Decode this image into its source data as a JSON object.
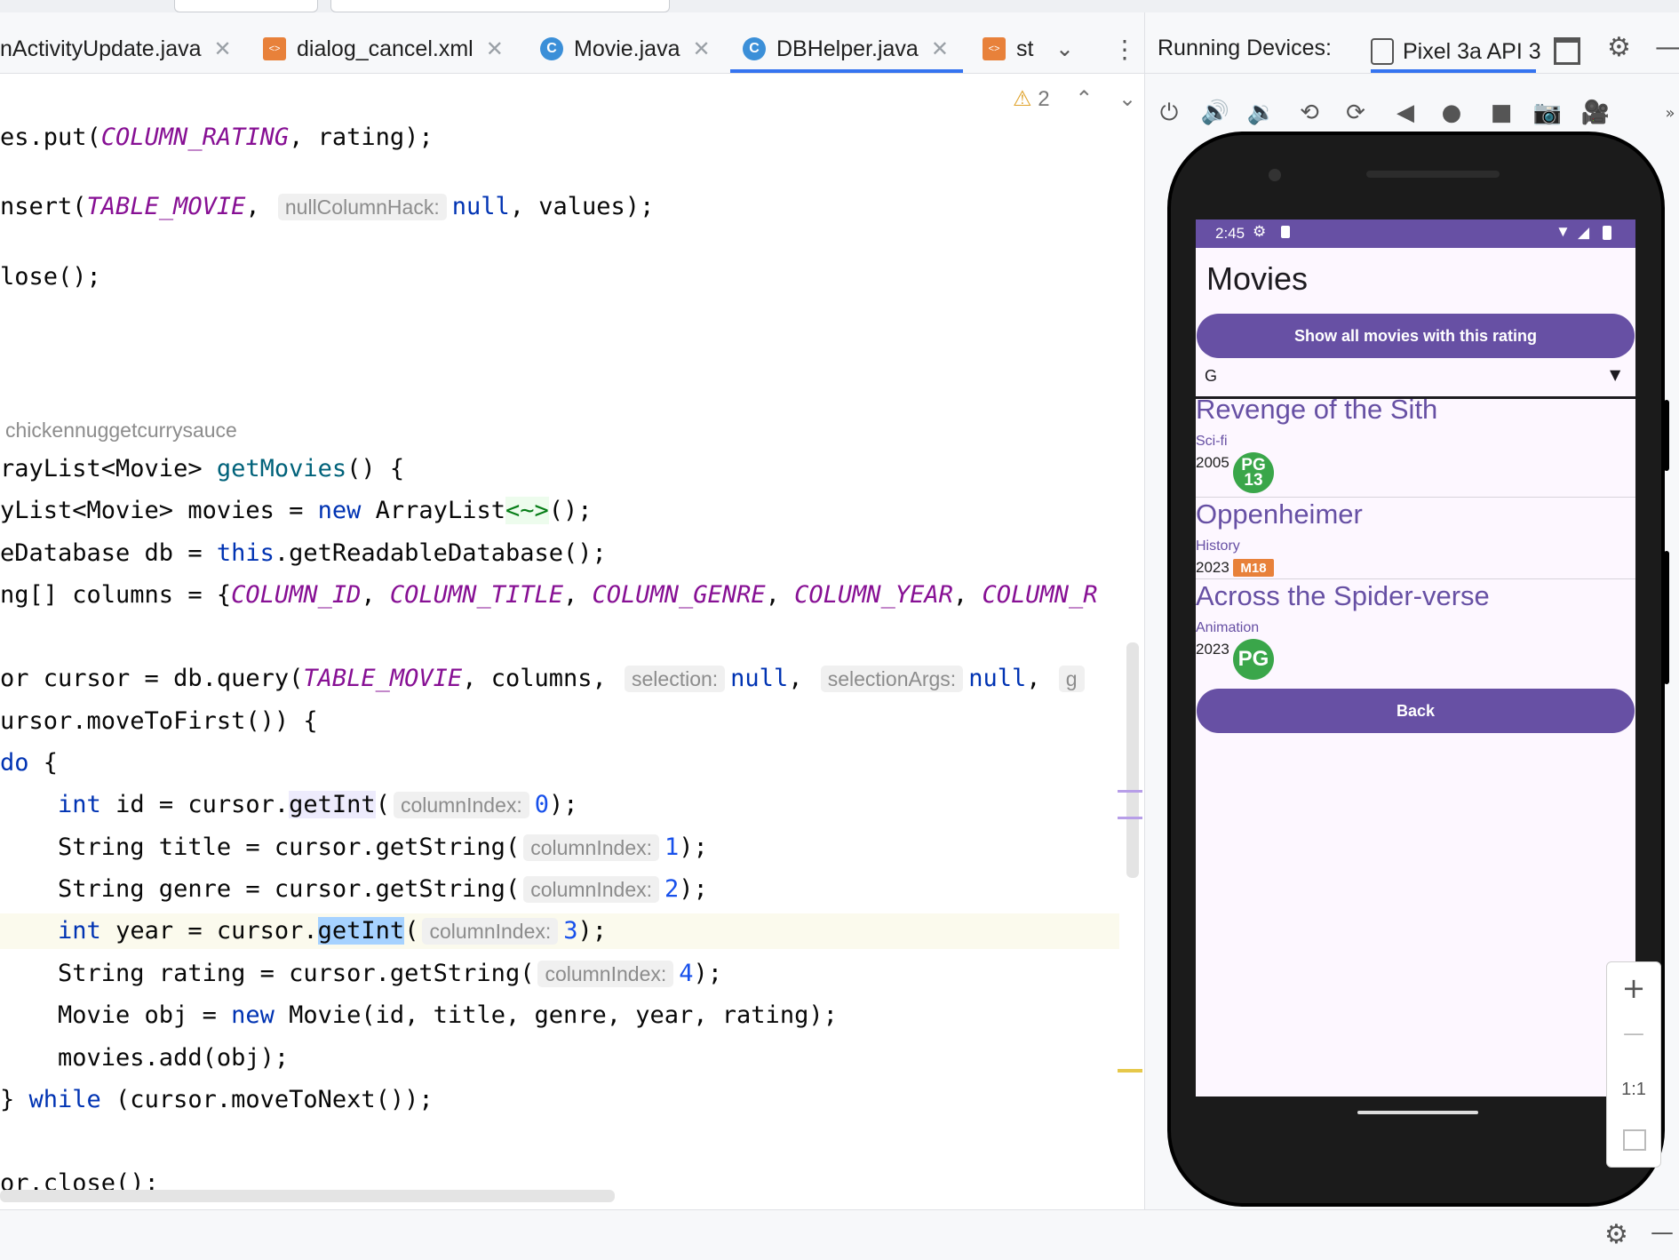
{
  "tabs": [
    {
      "label": "nActivityUpdate.java",
      "icon": "none"
    },
    {
      "label": "dialog_cancel.xml",
      "icon": "xml-file-icon"
    },
    {
      "label": "Movie.java",
      "icon": "class-icon"
    },
    {
      "label": "DBHelper.java",
      "icon": "class-icon",
      "active": true
    },
    {
      "label": "st",
      "icon": "xml-file-icon"
    }
  ],
  "editor": {
    "warning_count": "2",
    "author": "chickennuggetcurrysauce",
    "lines": {
      "l1a": "es.put(",
      "l1b": "COLUMN_RATING",
      "l1c": ", rating);",
      "l2a": "nsert(",
      "l2b": "TABLE_MOVIE",
      "l2c": ", ",
      "l2hint": "nullColumnHack:",
      "l2d": "null",
      "l2e": ", values);",
      "l3": "lose();",
      "l4a": "rayList<Movie> ",
      "l4b": "getMovies",
      "l4c": "() {",
      "l5a": "yList<Movie> movies = ",
      "l5b": "new",
      "l5c": " ArrayList",
      "l5d": "<~>",
      "l5e": "();",
      "l6a": "eDatabase db = ",
      "l6b": "this",
      "l6c": ".getReadableDatabase();",
      "l7a": "ng[] columns = {",
      "l7b": "COLUMN_ID",
      "l7c": ", ",
      "l7d": "COLUMN_TITLE",
      "l7e": ", ",
      "l7f": "COLUMN_GENRE",
      "l7g": ", ",
      "l7h": "COLUMN_YEAR",
      "l7i": ", ",
      "l7j": "COLUMN_R",
      "l8a": "or cursor = db.query(",
      "l8b": "TABLE_MOVIE",
      "l8c": ", columns, ",
      "l8hint1": "selection:",
      "l8d": "null",
      "l8e": ", ",
      "l8hint2": "selectionArgs:",
      "l8f": "null",
      "l8g": ", ",
      "l8hint3": "g",
      "l9": "ursor.moveToFirst()) {",
      "l10a": "do",
      "l10b": " {",
      "l11a": "    ",
      "l11b": "int",
      "l11c": " id = cursor.",
      "l11d": "getInt",
      "l11e": "(",
      "l11hint": "columnIndex:",
      "l11f": "0",
      "l11g": ");",
      "l12a": "    String title = cursor.getString(",
      "l12hint": "columnIndex:",
      "l12b": "1",
      "l12c": ");",
      "l13a": "    String genre = cursor.getString(",
      "l13hint": "columnIndex:",
      "l13b": "2",
      "l13c": ");",
      "l14a": "    ",
      "l14b": "int",
      "l14c": " year = cursor.",
      "l14d": "getInt",
      "l14e": "(",
      "l14hint": "columnIndex:",
      "l14f": "3",
      "l14g": ");",
      "l15a": "    String rating = cursor.getString(",
      "l15hint": "columnIndex:",
      "l15b": "4",
      "l15c": ");",
      "l16a": "    Movie obj = ",
      "l16b": "new",
      "l16c": " Movie(id, title, genre, year, rating);",
      "l17": "    movies.add(obj);",
      "l18a": "} ",
      "l18b": "while",
      "l18c": " (cursor.moveToNext());",
      "l19": "or.close();"
    }
  },
  "devices": {
    "title": "Running Devices:",
    "device_tab": "Pixel 3a API 3"
  },
  "phone": {
    "status_time": "2:45",
    "app_title": "Movies",
    "show_button": "Show all movies with this rating",
    "spinner_value": "G",
    "movies": [
      {
        "title": "Revenge of the Sith",
        "genre": "Sci-fi",
        "year": "2005",
        "rating": "PG 13"
      },
      {
        "title": "Oppenheimer",
        "genre": "History",
        "year": "2023",
        "rating": "M18"
      },
      {
        "title": "Across the Spider-verse",
        "genre": "Animation",
        "year": "2023",
        "rating": "PG"
      }
    ],
    "back_button": "Back"
  },
  "zoom": {
    "plus": "+",
    "minus": "—",
    "one_to_one": "1:1"
  },
  "colors": {
    "accent": "#6750a4",
    "badge_green": "#3aa64a",
    "badge_orange": "#e8813a",
    "keyword": "#0033b3",
    "constant": "#871094"
  }
}
